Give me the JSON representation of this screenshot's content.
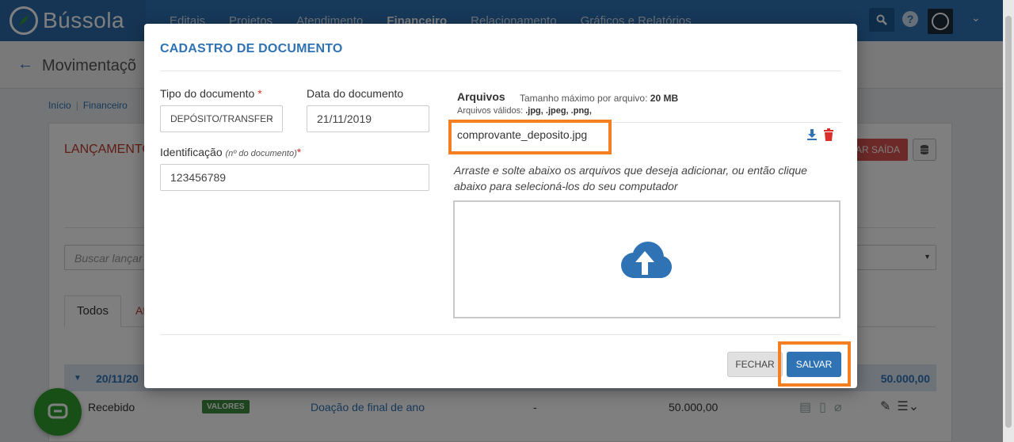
{
  "app": {
    "name": "Bússola"
  },
  "nav": {
    "items": [
      "Editais",
      "Projetos",
      "Atendimento",
      "Financeiro",
      "Relacionamento",
      "Gráficos e Relatórios"
    ],
    "active": "Financeiro",
    "help": "?"
  },
  "page": {
    "title": "Movimentaçõ",
    "breadcrumb": [
      "Início",
      "Financeiro"
    ],
    "section_title": "LANÇAMENTO",
    "saida_button": "AR SAÍDA",
    "search_placeholder": "Buscar lançar",
    "tabs": [
      "Todos",
      "At"
    ],
    "group": {
      "date": "20/11/20",
      "total": "50.000,00"
    },
    "row": {
      "status": "Recebido",
      "badge": "VALORES",
      "description": "Doação de final de ano",
      "dash": "-",
      "amount": "50.000,00"
    }
  },
  "modal": {
    "title": "CADASTRO DE DOCUMENTO",
    "tipo_label": "Tipo do documento",
    "tipo_value": "DEPÓSITO/TRANSFER",
    "data_label": "Data do documento",
    "data_value": "21/11/2019",
    "ident_label": "Identificação",
    "ident_hint": "(nº do documento)",
    "ident_value": "123456789",
    "required_mark": "*",
    "files_label": "Arquivos",
    "files_max_prefix": "Tamanho máximo por arquivo:",
    "files_max_value": "20 MB",
    "files_valid_prefix": "Arquivos válidos:",
    "files_valid_value": ".jpg, .jpeg, .png,",
    "file_name": "comprovante_deposito.jpg",
    "drop_text": "Arraste e solte abaixo os arquivos que deseja adicionar, ou então clique abaixo para selecioná-los do seu computador",
    "fechar": "FECHAR",
    "salvar": "SALVAR"
  },
  "colors": {
    "brand": "#2f73b5",
    "highlight": "#f47f20",
    "danger": "#d9302b",
    "success": "#3c8d40"
  }
}
